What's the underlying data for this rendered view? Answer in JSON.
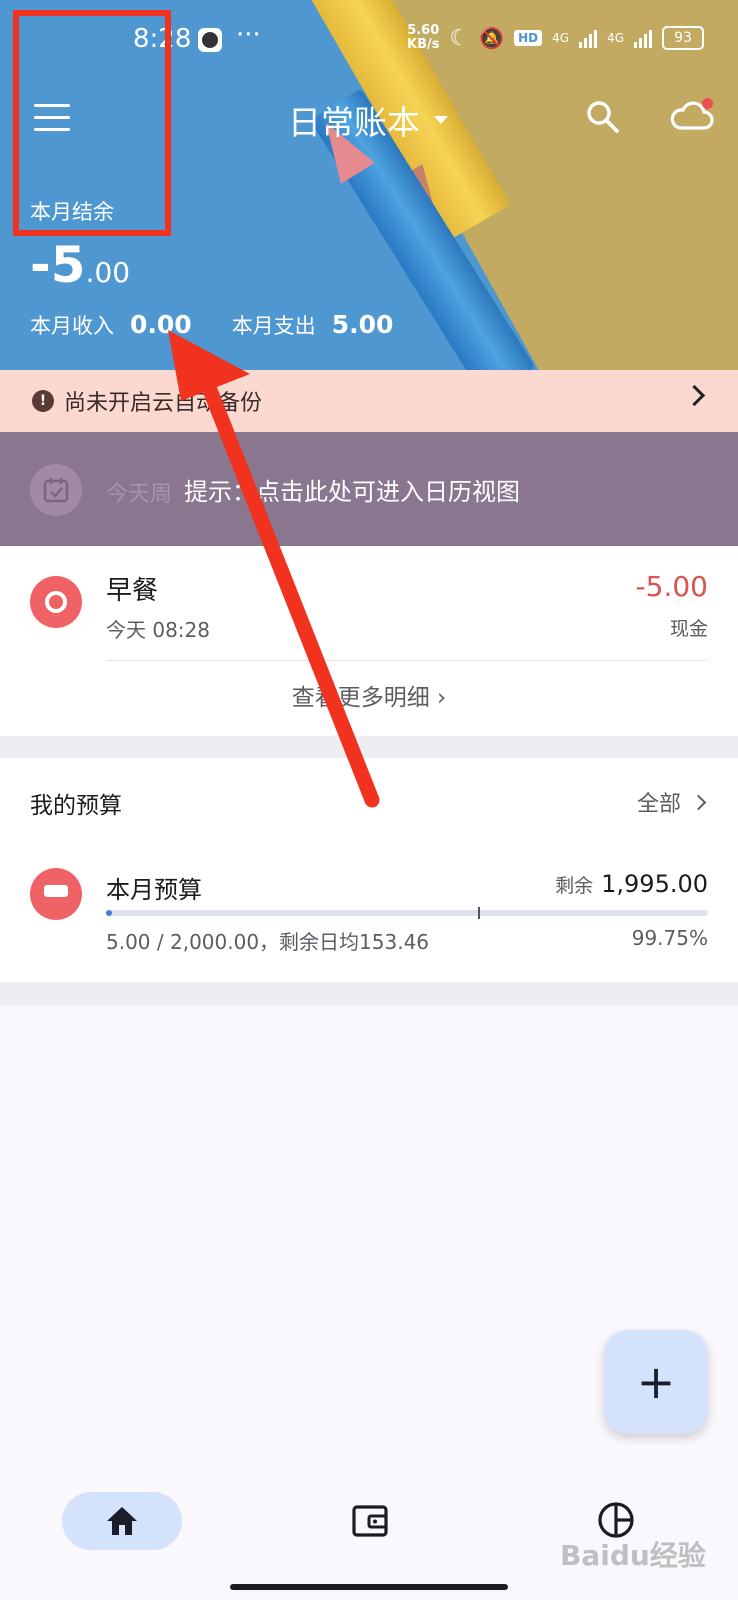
{
  "status_bar": {
    "time": "8:28",
    "dots": "···",
    "speed_value": "5.60",
    "speed_unit": "KB/s",
    "hd": "HD",
    "net1": "4G",
    "net2": "4G",
    "battery": "93"
  },
  "app_bar": {
    "book_title": "日常账本"
  },
  "summary": {
    "balance_label": "本月结余",
    "balance_int": "-5",
    "balance_dec": ".00",
    "income_label": "本月收入",
    "income_value": "0.00",
    "expense_label": "本月支出",
    "expense_value": "5.00"
  },
  "backup_banner": {
    "text": "尚未开启云自动备份"
  },
  "calendar": {
    "faded_text": "今天周",
    "tip": "提示：点击此处可进入日历视图"
  },
  "transactions": [
    {
      "name": "早餐",
      "time": "今天 08:28",
      "amount": "-5.00",
      "account": "现金"
    }
  ],
  "more_link": "查看更多明细",
  "budget": {
    "section_title": "我的预算",
    "all_label": "全部",
    "name": "本月预算",
    "remain_label": "剩余",
    "remain_value": "1,995.00",
    "detail": "5.00 / 2,000.00，剩余日均153.46",
    "percent": "99.75%",
    "progress_fraction": 0.0025
  },
  "fab": {
    "label": "+"
  },
  "watermark": "Baidu经验",
  "colors": {
    "accent_red": "#ef6366",
    "amount_red": "#d9534f",
    "annotation_red": "#f0321f",
    "fab_bg": "#d5e2fb"
  }
}
